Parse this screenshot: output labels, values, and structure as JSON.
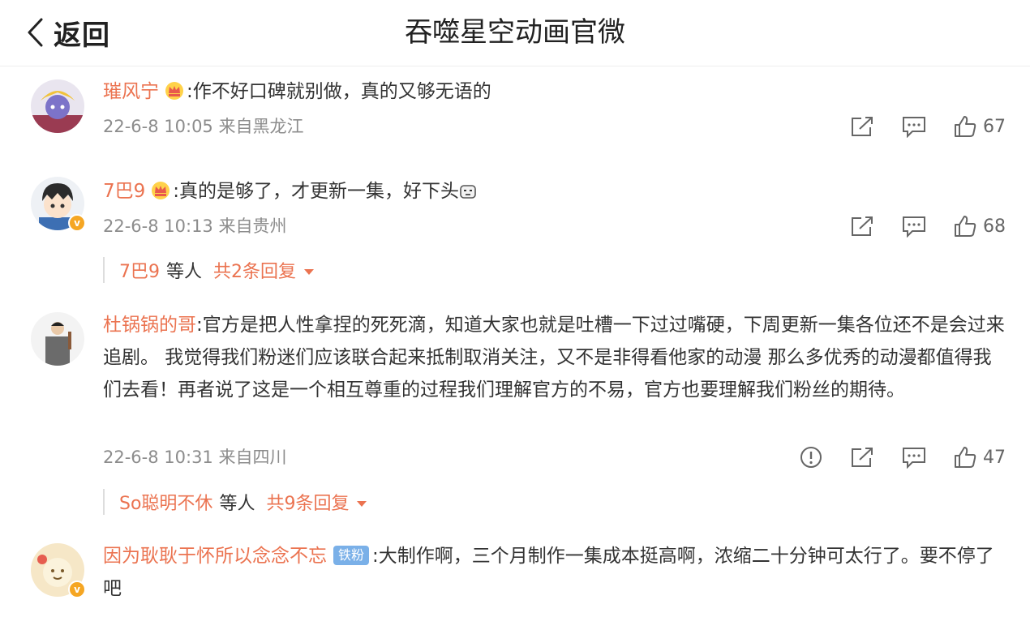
{
  "header": {
    "back_label": "返回",
    "title": "吞噬星空动画官微"
  },
  "accent_color": "#eb7350",
  "comments": [
    {
      "user": "璀风宁",
      "badge": "crown-badge-icon",
      "text": ":作不好口碑就别做，真的又够无语的",
      "time": "22-6-8 10:05",
      "location": "来自黑龙江",
      "likes": "67"
    },
    {
      "user": "7巴9",
      "badge": "crown-badge-icon",
      "text": ":真的是够了，才更新一集，好下头",
      "emoji": "speechless-emoji-icon",
      "time": "22-6-8 10:13",
      "location": "来自贵州",
      "likes": "68",
      "replies": {
        "user": "7巴9",
        "etc": "等人",
        "total": "共2条回复"
      }
    },
    {
      "user": "杜锅锅的哥",
      "text": ":官方是把人性拿捏的死死滴，知道大家也就是吐槽一下过过嘴硬，下周更新一集各位还不是会过来追剧。 我觉得我们粉迷们应该联合起来抵制取消关注，又不是非得看他家的动漫 那么多优秀的动漫都值得我们去看！再者说了这是一个相互尊重的过程我们理解官方的不易，官方也要理解我们粉丝的期待。",
      "time": "22-6-8 10:31",
      "location": "来自四川",
      "likes": "47",
      "replies": {
        "user": "So聪明不休",
        "etc": "等人",
        "total": "共9条回复"
      }
    },
    {
      "user": "因为耿耿于怀所以念念不忘",
      "fan_badge": "铁粉",
      "text": ":大制作啊，三个月制作一集成本挺高啊，浓缩二十分钟可太行了。要不停了吧"
    }
  ]
}
